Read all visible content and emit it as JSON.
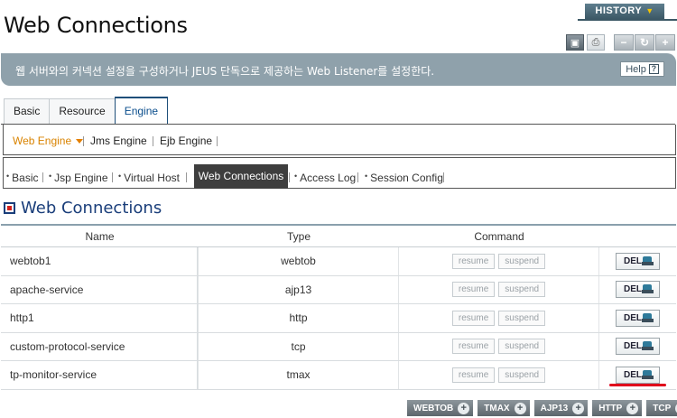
{
  "header": {
    "title": "Web Connections",
    "history_label": "HISTORY",
    "tool_icons": [
      "monitor-icon",
      "print-icon"
    ],
    "window_buttons": [
      "minimize-icon",
      "refresh-icon",
      "close-icon"
    ]
  },
  "description": {
    "text": "웹 서버와의 커넥션 설정을 구성하거나 JEUS 단독으로 제공하는 Web Listener를 설정한다.",
    "help_label": "Help",
    "help_icon": "?"
  },
  "tabs": [
    {
      "label": "Basic",
      "active": false
    },
    {
      "label": "Resource",
      "active": false
    },
    {
      "label": "Engine",
      "active": true
    }
  ],
  "engine_tabs": [
    {
      "label": "Web Engine",
      "active": true
    },
    {
      "label": "Jms Engine",
      "active": false
    },
    {
      "label": "Ejb Engine",
      "active": false
    }
  ],
  "web_engine_tabs": [
    {
      "label": "Basic"
    },
    {
      "label": "Jsp Engine"
    },
    {
      "label": "Virtual Host"
    },
    {
      "label": "Web Connections",
      "active": true
    },
    {
      "label": "Access Log"
    },
    {
      "label": "Session Config"
    }
  ],
  "section": {
    "title": "Web Connections"
  },
  "table": {
    "headers": {
      "name": "Name",
      "type": "Type",
      "command": "Command"
    },
    "rows": [
      {
        "name": "webtob1",
        "type": "webtob"
      },
      {
        "name": "apache-service",
        "type": "ajp13"
      },
      {
        "name": "http1",
        "type": "http"
      },
      {
        "name": "custom-protocol-service",
        "type": "tcp"
      },
      {
        "name": "tp-monitor-service",
        "type": "tmax"
      }
    ],
    "resume_label": "resume",
    "suspend_label": "suspend",
    "del_label": "DEL"
  },
  "add_buttons": [
    "WEBTOB",
    "TMAX",
    "AJP13",
    "HTTP",
    "TCP"
  ],
  "colors": {
    "accent": "#1a3e7a",
    "active_subtab": "#d98300",
    "desc_bar": "#8fa1ab",
    "highlight_underline": "#e0001b"
  }
}
